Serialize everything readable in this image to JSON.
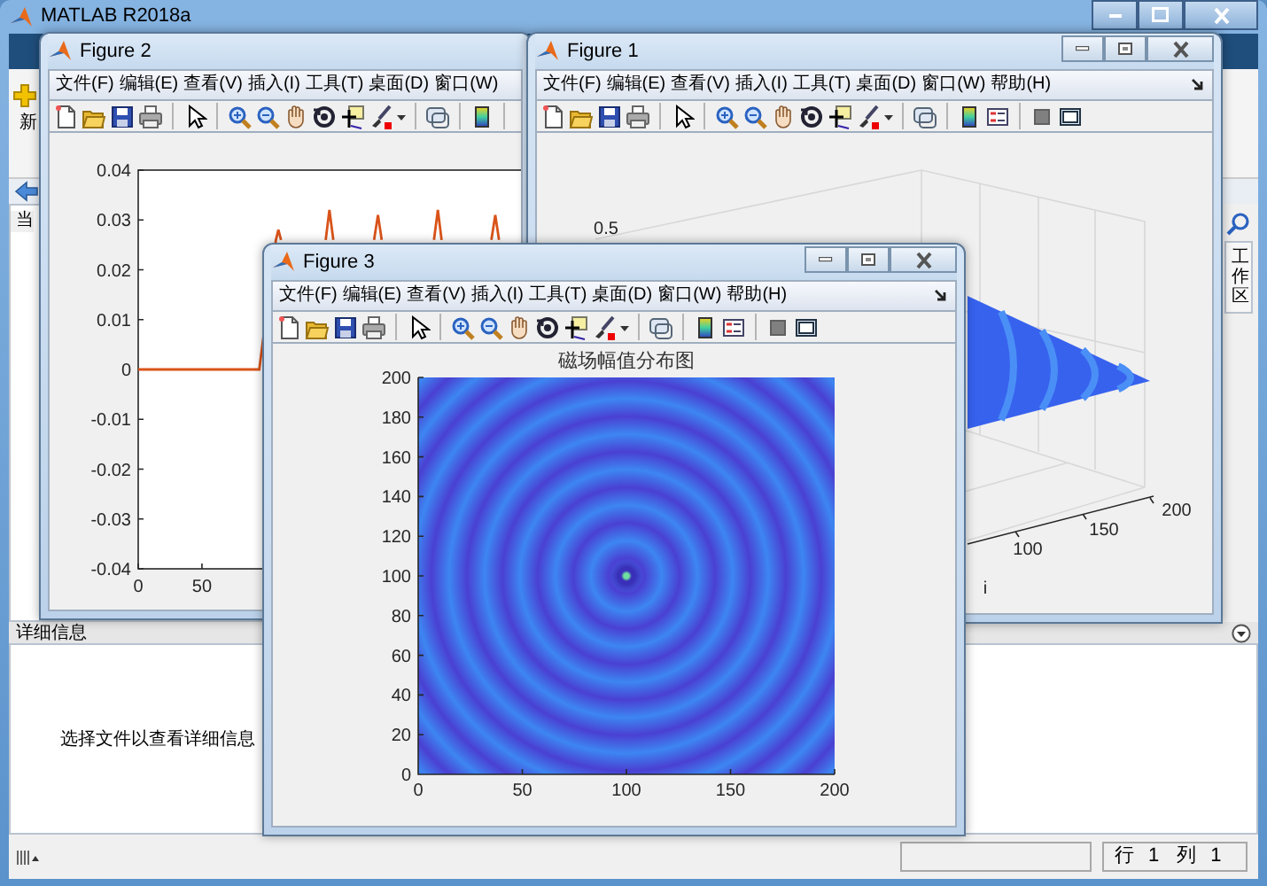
{
  "window": {
    "title": "MATLAB R2018a"
  },
  "ribbon": {
    "label_fragment": "新"
  },
  "current_folder": {
    "title_fragment": "当"
  },
  "side_tabs": [
    {
      "label": "工作区"
    }
  ],
  "details": {
    "title": "详细信息",
    "message": "选择文件以查看详细信息"
  },
  "status_bar": {
    "fields": [
      {
        "label": "行",
        "value": "1"
      },
      {
        "label": "列",
        "value": "1"
      }
    ]
  },
  "figures": [
    {
      "title": "Figure 2",
      "controls": false,
      "menu": [
        "文件(F)",
        "编辑(E)",
        "查看(V)",
        "插入(I)",
        "工具(T)",
        "桌面(D)",
        "窗口(W)"
      ],
      "plot": {
        "kind": "line",
        "chart_data": {
          "type": "line",
          "x": [
            0,
            24,
            48,
            72,
            95,
            108,
            110,
            112,
            147,
            150,
            153,
            185,
            188,
            191,
            232,
            235,
            238,
            277,
            280,
            283
          ],
          "series": [
            {
              "color": "#d95319",
              "values": [
                0,
                0,
                0,
                0,
                0,
                0.026,
                0.028,
                0.026,
                0.026,
                0.032,
                0.026,
                0.026,
                0.031,
                0.026,
                0.026,
                0.032,
                0.026,
                0.026,
                0.031,
                0.026
              ]
            }
          ],
          "xlim": [
            0,
            303
          ],
          "ylim": [
            -0.04,
            0.04
          ],
          "xticks": [
            0,
            50
          ],
          "yticks": [
            -0.04,
            -0.03,
            -0.02,
            -0.01,
            0,
            0.01,
            0.02,
            0.03,
            0.04
          ]
        }
      }
    },
    {
      "title": "Figure 1",
      "controls": true,
      "menu": [
        "文件(F)",
        "编辑(E)",
        "查看(V)",
        "插入(I)",
        "工具(T)",
        "桌面(D)",
        "窗口(W)",
        "帮助(H)"
      ],
      "plot": {
        "kind": "surface3d",
        "zticks": [
          "0.5"
        ],
        "xticks": [
          "100",
          "150",
          "200"
        ],
        "xlabel": "i"
      }
    },
    {
      "title": "Figure 3",
      "controls": true,
      "menu": [
        "文件(F)",
        "编辑(E)",
        "查看(V)",
        "插入(I)",
        "工具(T)",
        "桌面(D)",
        "窗口(W)",
        "帮助(H)"
      ],
      "plot": {
        "kind": "heatmap",
        "title": "磁场幅值分布图",
        "xticks": [
          "0",
          "50",
          "100",
          "150",
          "200"
        ],
        "yticks": [
          "200",
          "180",
          "160",
          "140",
          "120",
          "100",
          "80",
          "60",
          "40",
          "20",
          "0"
        ]
      }
    }
  ]
}
